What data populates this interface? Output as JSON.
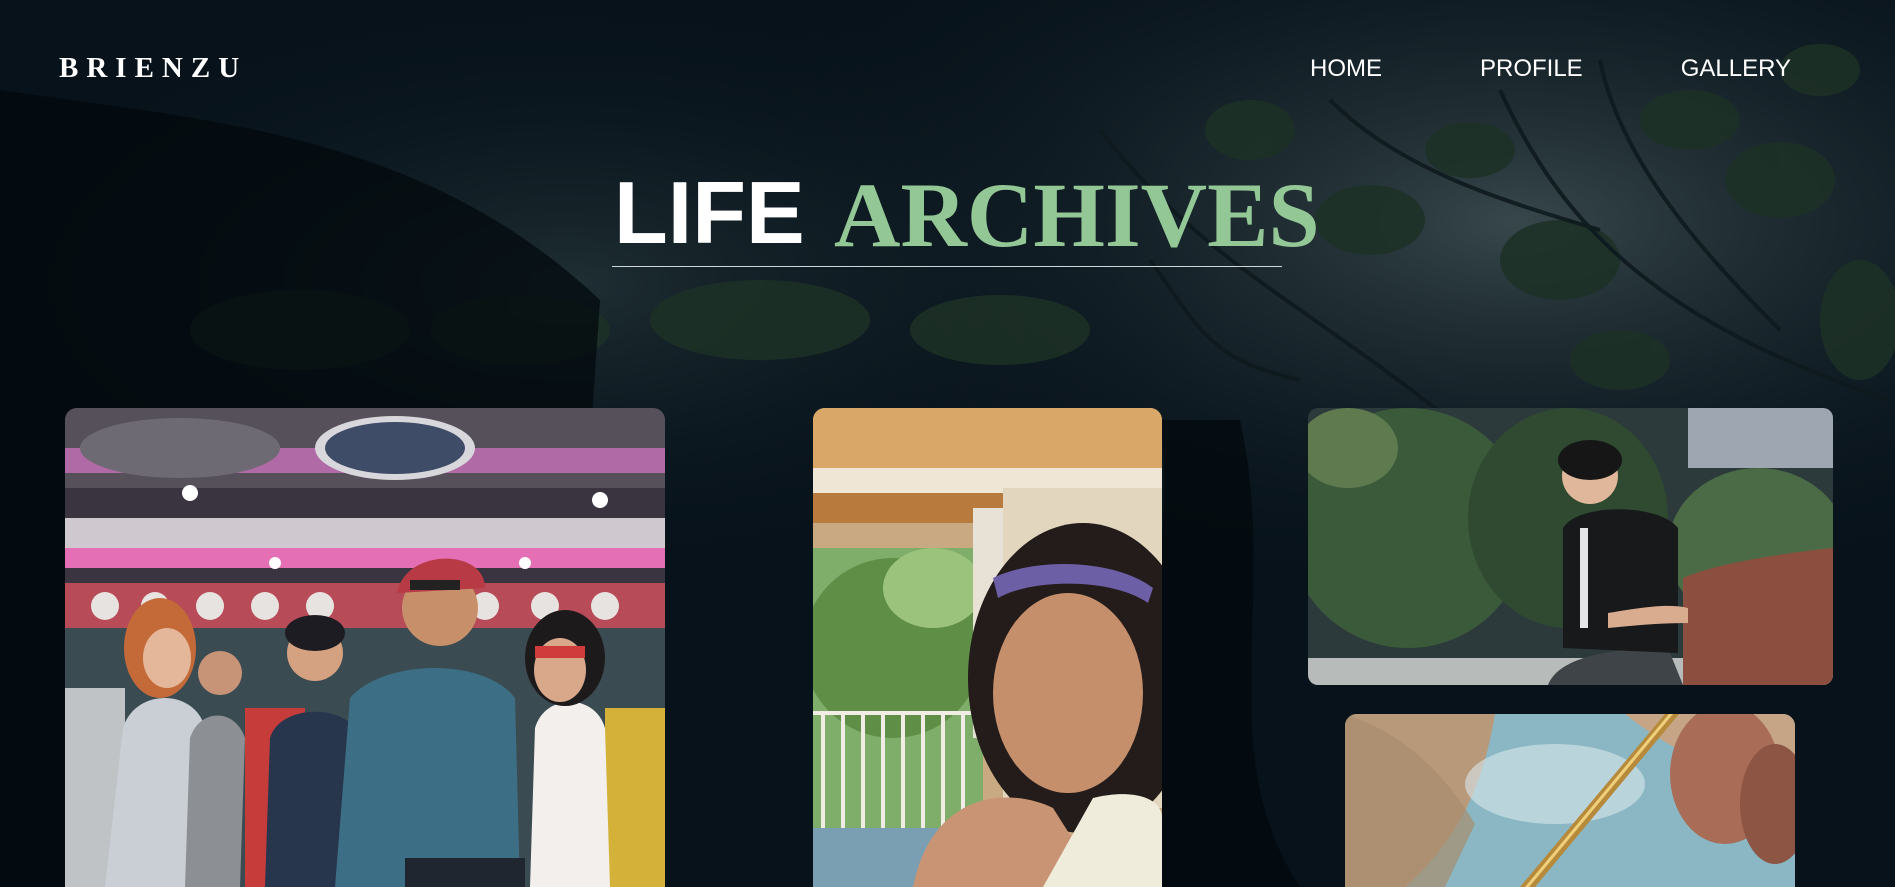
{
  "brand": {
    "name": "BRIENZU"
  },
  "nav": {
    "items": [
      {
        "label": "HOME"
      },
      {
        "label": "PROFILE"
      },
      {
        "label": "GALLERY"
      }
    ]
  },
  "hero": {
    "title_part1": "LIFE",
    "title_part2": "ARCHIVES"
  },
  "gallery": {
    "photos": [
      {
        "subject": "family group photo in arcade"
      },
      {
        "subject": "girl with headband portrait"
      },
      {
        "subject": "young man sitting outdoors at night"
      },
      {
        "subject": "close-up of hand with golden pen on fabric"
      }
    ]
  },
  "colors": {
    "background": "#07121a",
    "accent_green": "#93c796",
    "text": "#ffffff"
  }
}
